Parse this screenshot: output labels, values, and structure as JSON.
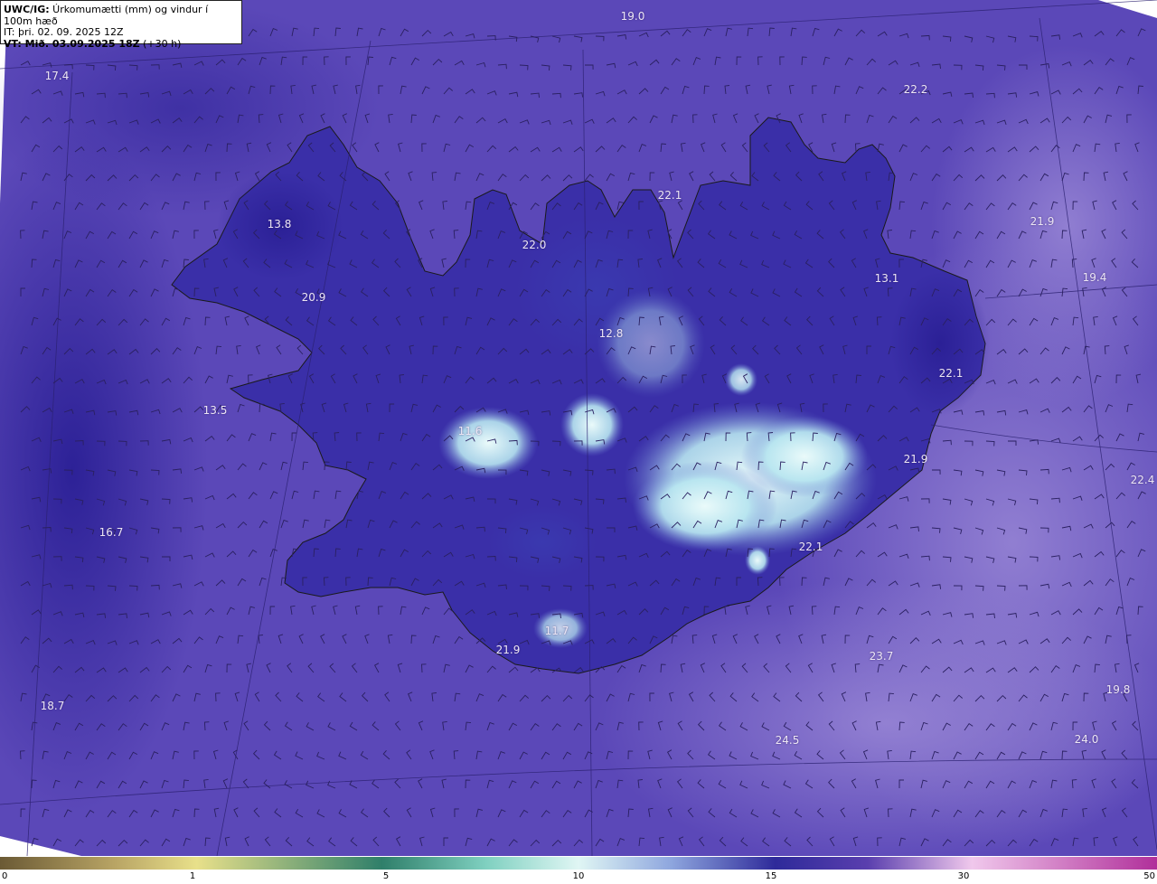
{
  "header": {
    "line1_bold": "UWC/IG:",
    "line1_text": " Úrkomumætti (mm) og vindur í 100m hæð",
    "line2": "IT: þri. 02. 09. 2025 12Z",
    "line3_bold": "VT: Mið. 03.09.2025 18Z",
    "line3_text": " (+30 h)"
  },
  "map_labels": [
    "19.0",
    "17.4",
    "22.2",
    "21.9",
    "13.8",
    "22.1",
    "22.0",
    "20.9",
    "13.1",
    "19.4",
    "12.8",
    "22.1",
    "13.5",
    "11.6",
    "21.9",
    "22.4",
    "16.7",
    "22.1",
    "11.7",
    "21.9",
    "23.7",
    "18.7",
    "19.8",
    "24.5",
    "24.0"
  ],
  "colorbar": {
    "ticks": [
      "0",
      "1",
      "5",
      "10",
      "15",
      "30",
      "50"
    ],
    "colors": [
      "#6b5a35",
      "#b9a565",
      "#e8e08a",
      "#2f7f6a",
      "#7fd0c0",
      "#e0f6f4",
      "#8ea6de",
      "#2e2a9a",
      "#5a3fae",
      "#f0c8ec",
      "#b02f9a"
    ]
  },
  "colors": {
    "field_base": "#5b48b8",
    "field_light": "#8a76cc",
    "field_dark": "#3428a0",
    "high_precip": "#dff4f6",
    "coastline": "#1a1a1a",
    "wind_barbs": "#2a2060"
  }
}
